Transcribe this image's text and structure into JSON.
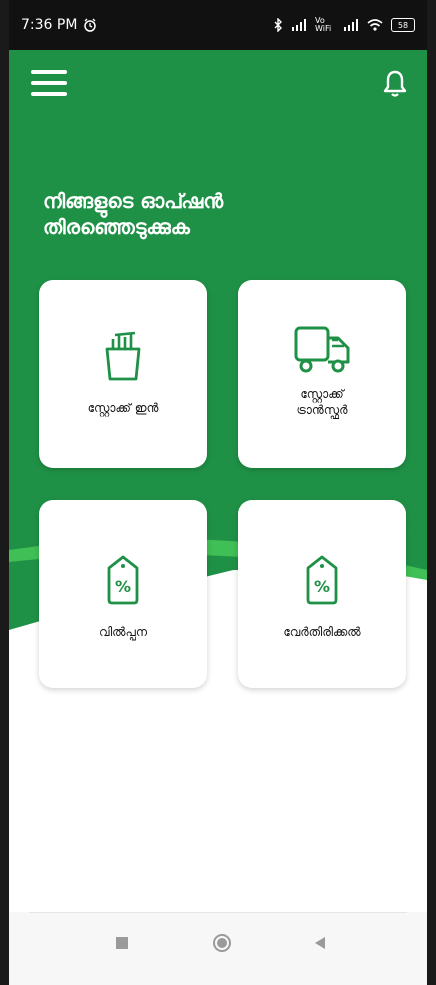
{
  "status_bar": {
    "time": "7:36 PM",
    "alarm_icon": "alarm-clock-icon",
    "signal_text": "Vo WiFi",
    "battery": "58"
  },
  "header": {
    "menu_icon": "hamburger-menu-icon",
    "bell_icon": "bell-icon"
  },
  "main": {
    "title": "നിങ്ങളുടെ ഓപ്ഷൻ\nതിരഞ്ഞെടുക്കുക",
    "cards": [
      {
        "label": "സ്റ്റോക്ക് ഇൻ",
        "icon": "stock-in-icon"
      },
      {
        "label": "സ്റ്റോക്ക്\nട്രാൻസ്ഫർ",
        "icon": "delivery-truck-icon"
      },
      {
        "label": "വിൽപ്പന",
        "icon": "price-tag-icon"
      },
      {
        "label": "വേർതിരിക്കൽ",
        "icon": "price-tag-icon"
      }
    ]
  },
  "colors": {
    "primary_green": "#1f9146",
    "wave_green": "#3fbf55",
    "white": "#ffffff"
  },
  "nav_bar": {
    "recents_icon": "square-recents-icon",
    "home_icon": "circle-home-icon",
    "back_icon": "triangle-back-icon"
  }
}
